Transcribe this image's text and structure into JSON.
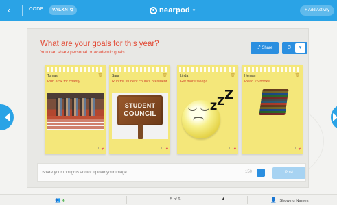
{
  "topbar": {
    "back_icon": "chevron-left-icon",
    "code_label": "CODE:",
    "code_value": "VALXN",
    "brand": "nearpod",
    "brand_caret": "▾",
    "add_activity": "+ Add Activity"
  },
  "panel": {
    "title": "What are your goals for this year?",
    "subtitle": "You can share personal or academic goals.",
    "share_label": "Share",
    "toggle_left": "⏱",
    "toggle_right": "♥"
  },
  "notes": [
    {
      "name": "Tomas",
      "goal": "Run a 5k for charity",
      "image": "runners"
    },
    {
      "name": "Sara",
      "goal": "Run for student council president",
      "image": "sign",
      "image_text": [
        "STUDENT",
        "COUNCIL"
      ]
    },
    {
      "name": "Linda",
      "goal": "Get more sleep!",
      "image": "sleep-emoji",
      "image_text": "ZZZ"
    },
    {
      "name": "Hernan",
      "goal": "Read 25 books",
      "image": "books"
    }
  ],
  "input": {
    "placeholder": "Share your thoughts and/or upload your image",
    "char_count": "150",
    "post_label": "Post"
  },
  "bottombar": {
    "students_count": "4",
    "page": "5 of 6",
    "names_label": "Showing Names"
  },
  "colors": {
    "accent": "#2aa3e6",
    "title": "#e24a35",
    "note": "#f4e77a"
  }
}
